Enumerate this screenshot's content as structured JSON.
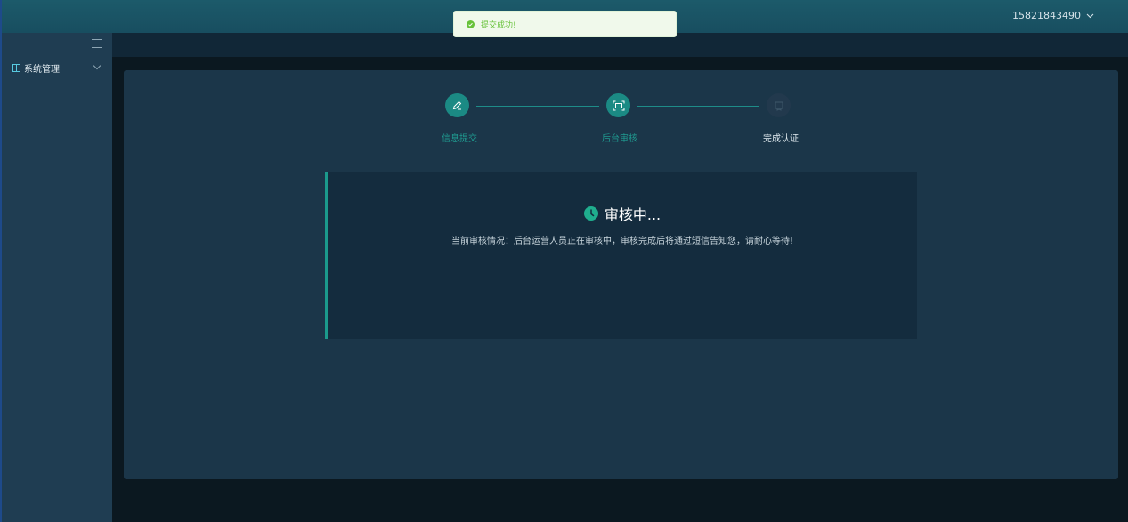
{
  "header": {
    "user_phone": "15821843490"
  },
  "sidebar": {
    "menu_items": [
      {
        "label": "系统管理",
        "icon": "grid-icon"
      }
    ]
  },
  "toast": {
    "message": "提交成功!",
    "icon": "check-circle-icon",
    "color": "#67c23a"
  },
  "steps": [
    {
      "label": "信息提交",
      "icon": "edit-icon",
      "state": "done"
    },
    {
      "label": "后台审核",
      "icon": "scan-icon",
      "state": "active"
    },
    {
      "label": "完成认证",
      "icon": "certificate-icon",
      "state": "pending"
    }
  ],
  "status": {
    "title": "审核中...",
    "icon": "clock-icon",
    "description": "当前审核情况：后台运营人员正在审核中，审核完成后将通过短信告知您，请耐心等待!"
  },
  "colors": {
    "accent": "#1b8a84",
    "topbar": "#1c5a6a",
    "sidebar": "#1f3d52",
    "card": "#1b3649"
  }
}
